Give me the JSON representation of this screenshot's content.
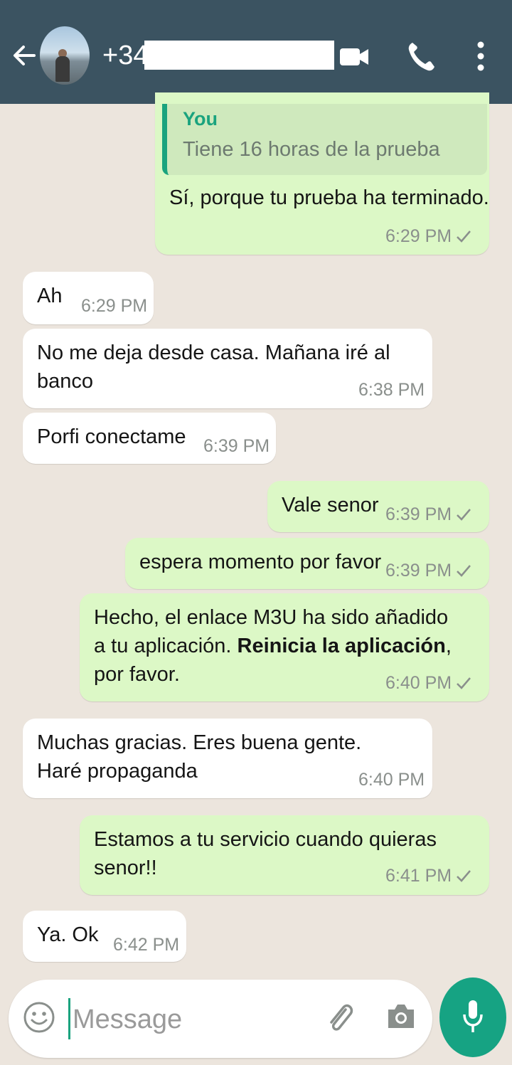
{
  "header": {
    "phone_prefix": "+34"
  },
  "quoted": {
    "author": "You",
    "text": "Tiene 16 horas de la prueba"
  },
  "messages": [
    {
      "dir": "out",
      "text": "Sí, porque tu prueba ha terminado.",
      "time": "6:29 PM"
    },
    {
      "dir": "in",
      "text": "Ah",
      "time": "6:29 PM"
    },
    {
      "dir": "in",
      "text": "No me deja desde casa. Mañana iré al banco",
      "time": "6:38 PM"
    },
    {
      "dir": "in",
      "text": "Porfi conectame",
      "time": "6:39 PM"
    },
    {
      "dir": "out",
      "text": "Vale senor",
      "time": "6:39 PM"
    },
    {
      "dir": "out",
      "text": "espera momento por favor",
      "time": "6:39 PM"
    },
    {
      "dir": "out",
      "text_before": "Hecho, el enlace M3U ha sido añadido a tu aplicación. ",
      "text_bold": "Reinicia la aplicación",
      "text_after": ", por favor.",
      "time": "6:40 PM"
    },
    {
      "dir": "in",
      "text": "Muchas gracias. Eres buena gente. Haré propaganda",
      "time": "6:40 PM"
    },
    {
      "dir": "out",
      "text": "Estamos a tu servicio cuando quieras senor!!",
      "time": "6:41 PM"
    },
    {
      "dir": "in",
      "text": "Ya. Ok",
      "time": "6:42 PM"
    }
  ],
  "composer": {
    "placeholder": "Message"
  },
  "colors": {
    "header": "#3b5361",
    "background": "#ece5dd",
    "outgoing_bubble": "#dcf8c6",
    "incoming_bubble": "#ffffff",
    "accent": "#16a383"
  },
  "icons": [
    "back-arrow-icon",
    "video-call-icon",
    "phone-icon",
    "more-vert-icon",
    "check-icon",
    "emoji-icon",
    "attach-icon",
    "camera-icon",
    "mic-icon"
  ]
}
